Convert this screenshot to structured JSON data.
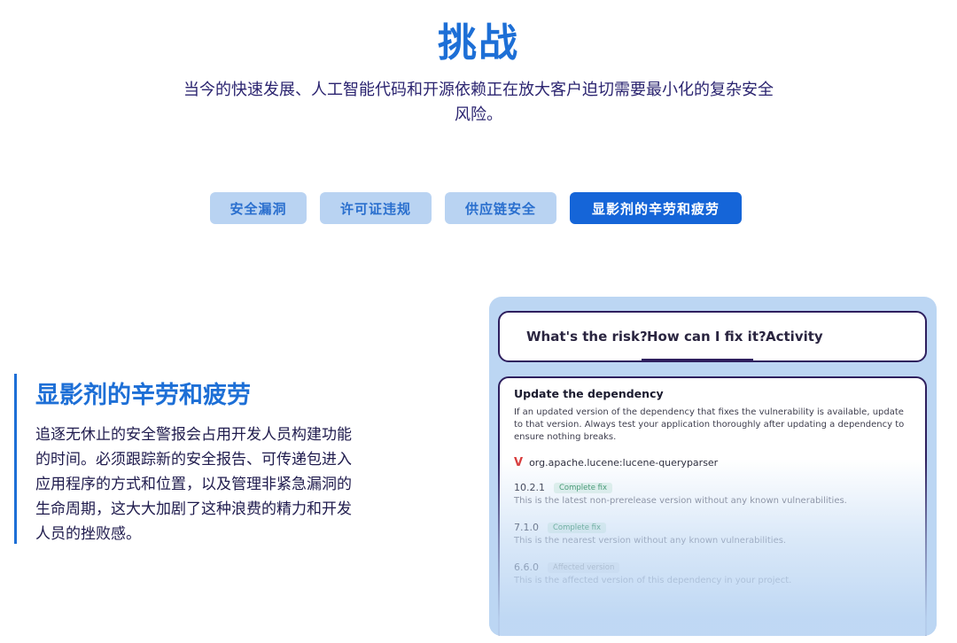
{
  "header": {
    "title": "挑战",
    "subtitle_line1": "当今的快速发展、人工智能代码和开源依赖正在放大客户迫切需要最小化的复杂安全",
    "subtitle_line2": "风险。"
  },
  "tabs": [
    {
      "label": "安全漏洞",
      "active": false
    },
    {
      "label": "许可证违规",
      "active": false
    },
    {
      "label": "供应链安全",
      "active": false
    },
    {
      "label": "显影剂的辛劳和疲劳",
      "active": true
    }
  ],
  "section": {
    "heading": "显影剂的辛劳和疲劳",
    "body_lines": [
      "追逐无休止的安全警报会占用开发人员构建功能",
      "的时间。必须跟踪新的安全报告、可传递包进入",
      "应用程序的方式和位置，以及管理非紧急漏洞的",
      "生命周期，这大大加剧了这种浪费的精力和开发",
      "人员的挫败感。"
    ]
  },
  "panel": {
    "tabs": [
      {
        "label": "What's the risk?"
      },
      {
        "label": "How can I fix it?",
        "active": true
      },
      {
        "label": "Activity"
      }
    ],
    "card": {
      "title": "Update the dependency",
      "description": "If an updated version of the dependency that fixes the vulnerability is available, update to that version. Always test your application thoroughly after updating a dependency to ensure nothing breaks.",
      "package_icon": "snyk-v-icon",
      "package": "org.apache.lucene:lucene-queryparser",
      "versions": [
        {
          "version": "10.2.1",
          "badge": "Complete fix",
          "description": "This is the latest non-prerelease version without any known vulnerabilities."
        },
        {
          "version": "7.1.0",
          "badge": "Complete fix",
          "description": "This is the nearest version without any known vulnerabilities."
        },
        {
          "version": "6.6.0",
          "badge": "Affected version",
          "description": "This is the affected version of this dependency in your project."
        }
      ]
    }
  },
  "colors": {
    "accent": "#1d6fd6",
    "active_tab_bg": "#1565d8",
    "inactive_tab_bg": "#b9d3f2",
    "panel_bg": "#bcd6f3",
    "text_dark": "#1f1b4d"
  }
}
